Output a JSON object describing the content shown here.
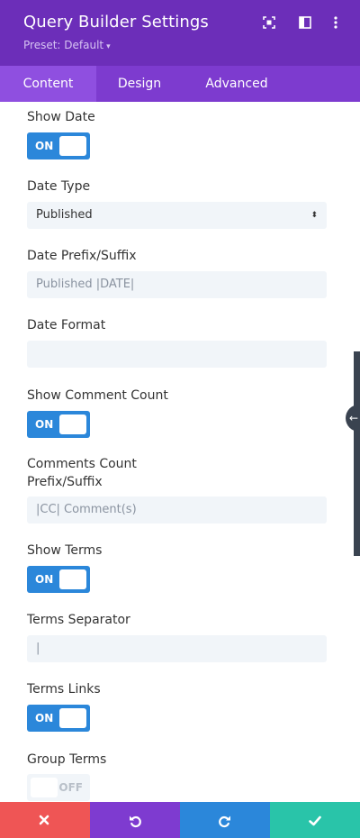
{
  "header": {
    "title": "Query Builder Settings",
    "preset": "Preset: Default",
    "icons": [
      "focus-icon",
      "split-view-icon",
      "more-icon"
    ]
  },
  "tabs": [
    {
      "label": "Content",
      "active": true
    },
    {
      "label": "Design",
      "active": false
    },
    {
      "label": "Advanced",
      "active": false
    }
  ],
  "settings": {
    "show_date": {
      "label": "Show Date",
      "state": "ON"
    },
    "date_type": {
      "label": "Date Type",
      "value": "Published"
    },
    "date_prefix": {
      "label": "Date Prefix/Suffix",
      "placeholder": "Published |DATE|"
    },
    "date_format": {
      "label": "Date Format",
      "value": ""
    },
    "show_comment_count": {
      "label": "Show Comment Count",
      "state": "ON"
    },
    "comments_prefix": {
      "label_line1": "Comments Count",
      "label_line2": "Prefix/Suffix",
      "placeholder": "|CC| Comment(s)"
    },
    "show_terms": {
      "label": "Show Terms",
      "state": "ON"
    },
    "terms_separator": {
      "label": "Terms Separator",
      "value": "|"
    },
    "terms_links": {
      "label": "Terms Links",
      "state": "ON"
    },
    "group_terms": {
      "label": "Group Terms",
      "state": "OFF"
    }
  },
  "footer": {
    "colors": {
      "cancel": "#ef5555",
      "undo": "#7e3bd0",
      "redo": "#2b87da",
      "save": "#29c4a9"
    }
  },
  "colors": {
    "header": "#6c2eb9",
    "tabs": "#7d3bcf",
    "accent": "#2b87da"
  }
}
